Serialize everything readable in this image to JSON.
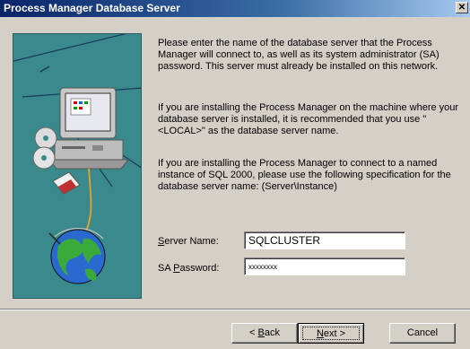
{
  "window": {
    "title": "Process Manager Database Server",
    "close_glyph": "✕"
  },
  "instructions": {
    "p1": "Please enter the name of the database server that the Process Manager will connect to, as well as its system administrator (SA) password. This server must already be installed on this network.",
    "p2": "If you are installing the Process Manager on the machine where your database server is installed, it is recommended that you use \"<LOCAL>\" as the database server name.",
    "p3": "If you are installing the Process Manager to connect to a named instance of SQL 2000, please use the following specification for the database server name: (Server\\Instance)"
  },
  "form": {
    "server_label_prefix": "",
    "server_label_key": "S",
    "server_label_rest": "erver Name:",
    "server_value": "SQLCLUSTER",
    "pass_label_prefix": "SA ",
    "pass_label_key": "P",
    "pass_label_rest": "assword:",
    "pass_value": "xxxxxxxx"
  },
  "buttons": {
    "back_prefix": "< ",
    "back_key": "B",
    "back_rest": "ack",
    "next_key": "N",
    "next_rest": "ext >",
    "cancel": "Cancel"
  },
  "icons": {
    "illustration": "computer-network-globe-illustration",
    "close": "close-icon"
  },
  "colors": {
    "titlebar_start": "#0a246a",
    "titlebar_end": "#a6caf0",
    "panel_bg": "#3a8a8d",
    "dialog_bg": "#d4d0c8"
  }
}
